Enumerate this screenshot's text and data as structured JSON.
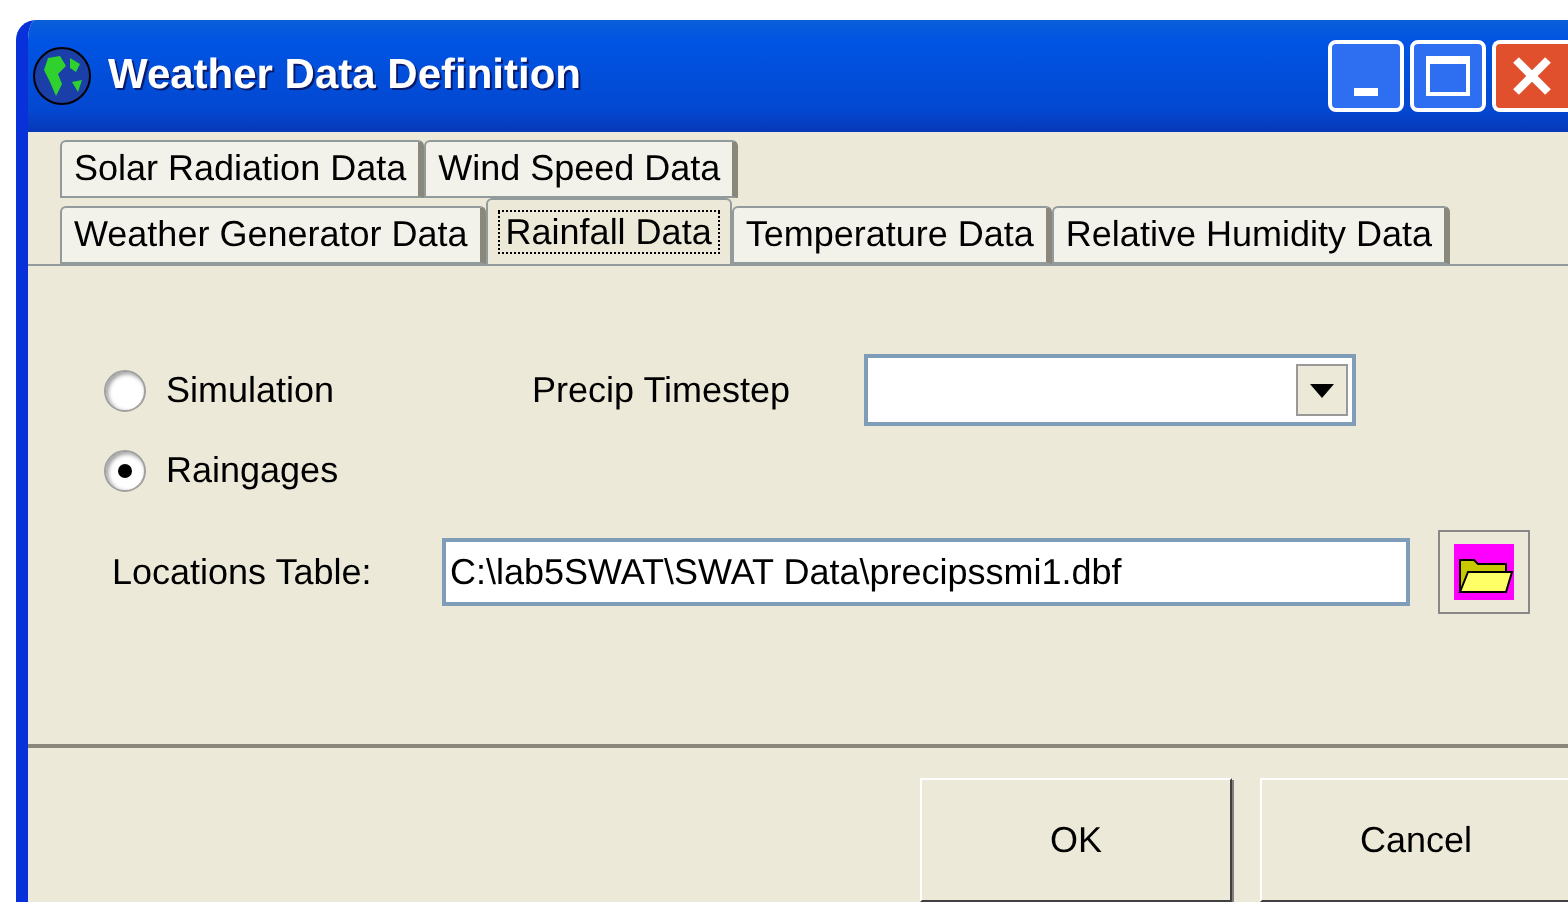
{
  "window": {
    "title": "Weather Data Definition"
  },
  "tab_rows": [
    [
      {
        "label": "Solar Radiation Data",
        "selected": false
      },
      {
        "label": "Wind Speed Data",
        "selected": false
      }
    ],
    [
      {
        "label": "Weather Generator Data",
        "selected": false
      },
      {
        "label": "Rainfall Data",
        "selected": true
      },
      {
        "label": "Temperature Data",
        "selected": false
      },
      {
        "label": "Relative Humidity Data",
        "selected": false
      }
    ]
  ],
  "radios": [
    {
      "label": "Simulation",
      "selected": false
    },
    {
      "label": "Raingages",
      "selected": true
    }
  ],
  "precip_timestep": {
    "label": "Precip Timestep"
  },
  "locations_table": {
    "label": "Locations Table:",
    "value": "C:\\lab5SWAT\\SWAT Data\\precipssmi1.dbf"
  },
  "buttons": [
    "OK",
    "Cancel"
  ]
}
